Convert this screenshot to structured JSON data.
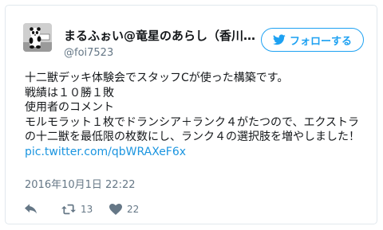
{
  "author": {
    "display_name": "まるふぉい@竜星のあらし（香川県で遊戯王カードを楽しむ）",
    "handle": "@foi7523",
    "avatar_icon": "panda-avatar"
  },
  "follow_button": {
    "label": "フォローする",
    "icon": "twitter-bird-icon",
    "color": "#1da1f2"
  },
  "tweet": {
    "lines": [
      "十二獣デッキ体験会でスタッフCが使った構築です。",
      "戦績は１０勝１敗",
      "使用者のコメント",
      "モルモラット１枚でドランシア＋ランク４がたつので、エクストラの十二獣を最低限の枚数にし、ランク４の選択肢を増やしました！ "
    ],
    "link": "pic.twitter.com/qbWRAXeF6x",
    "link_color": "#1b95e0"
  },
  "timestamp": "2016年10月1日 22:22",
  "actions": {
    "reply_icon": "reply-icon",
    "retweet_icon": "retweet-icon",
    "retweet_count": "13",
    "like_icon": "heart-icon",
    "like_count": "22"
  }
}
